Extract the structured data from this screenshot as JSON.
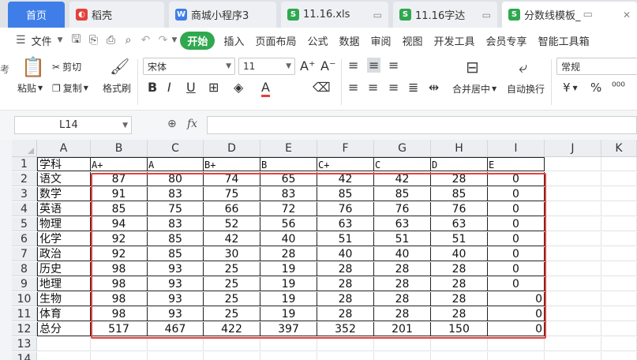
{
  "tabs": [
    {
      "label": "首页",
      "icon": "home"
    },
    {
      "label": "稻壳",
      "icon": "docer-icon",
      "color": "#e5403a"
    },
    {
      "label": "商城小程序3",
      "icon": "word-icon",
      "color": "#3f7ee8"
    },
    {
      "label": "11.16.xls",
      "icon": "sheet-icon",
      "color": "#2fa84f"
    },
    {
      "label": "11.16字达",
      "icon": "sheet-icon",
      "color": "#2fa84f"
    },
    {
      "label": "分数线模板_",
      "icon": "sheet-icon",
      "color": "#2fa84f"
    }
  ],
  "menubar": {
    "file": "文件",
    "items": [
      "开始",
      "插入",
      "页面布局",
      "公式",
      "数据",
      "审阅",
      "视图",
      "开发工具",
      "会员专享",
      "智能工具箱"
    ]
  },
  "ribbon": {
    "paste": "粘贴",
    "cut": "剪切",
    "copy": "复制",
    "format_painter": "格式刷",
    "font_name": "宋体",
    "font_size": "11",
    "merge_center": "合并居中",
    "wrap_text": "自动换行",
    "number_format": "常规",
    "currency_symbol": "¥",
    "percent_symbol": "%",
    "left_cut_text": "考"
  },
  "formula_bar": {
    "cell_ref": "L14",
    "fx": "fx",
    "value": ""
  },
  "sheet": {
    "columns": [
      "A",
      "B",
      "C",
      "D",
      "E",
      "F",
      "G",
      "H",
      "I",
      "J",
      "K"
    ],
    "rows": [
      "1",
      "2",
      "3",
      "4",
      "5",
      "6",
      "7",
      "8",
      "9",
      "10",
      "11",
      "12",
      "13",
      "14"
    ],
    "header_row": [
      "学科",
      "A+",
      "A",
      "B+",
      "B",
      "C+",
      "C",
      "D",
      "E"
    ],
    "data": [
      [
        "语文",
        "87",
        "80",
        "74",
        "65",
        "42",
        "42",
        "28",
        "0"
      ],
      [
        "数学",
        "91",
        "83",
        "75",
        "83",
        "85",
        "85",
        "85",
        "0"
      ],
      [
        "英语",
        "85",
        "75",
        "66",
        "72",
        "76",
        "76",
        "76",
        "0"
      ],
      [
        "物理",
        "94",
        "83",
        "52",
        "56",
        "63",
        "63",
        "63",
        "0"
      ],
      [
        "化学",
        "92",
        "85",
        "42",
        "40",
        "51",
        "51",
        "51",
        "0"
      ],
      [
        "政治",
        "92",
        "85",
        "30",
        "28",
        "40",
        "40",
        "40",
        "0"
      ],
      [
        "历史",
        "98",
        "93",
        "25",
        "19",
        "28",
        "28",
        "28",
        "0"
      ],
      [
        "地理",
        "98",
        "93",
        "25",
        "19",
        "28",
        "28",
        "28",
        "0"
      ],
      [
        "生物",
        "98",
        "93",
        "25",
        "19",
        "28",
        "28",
        "28",
        "0"
      ],
      [
        "体育",
        "98",
        "93",
        "25",
        "19",
        "28",
        "28",
        "28",
        "0"
      ],
      [
        "总分",
        "517",
        "467",
        "422",
        "397",
        "352",
        "201",
        "150",
        "0"
      ]
    ],
    "selection_color": "#e8413a"
  }
}
